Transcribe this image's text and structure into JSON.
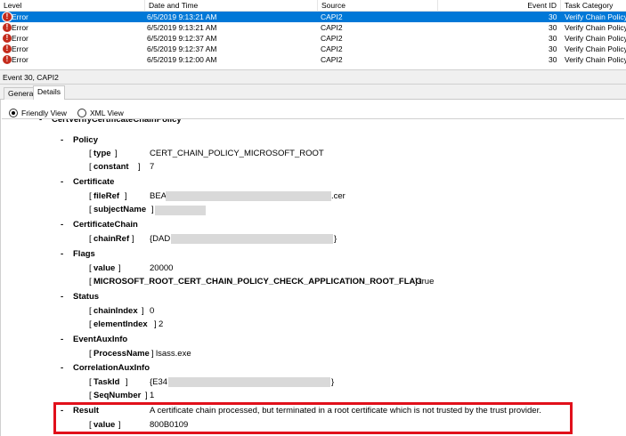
{
  "columns": {
    "level": "Level",
    "datetime": "Date and Time",
    "source": "Source",
    "event_id": "Event ID",
    "task_category": "Task Category"
  },
  "events": [
    {
      "level": "Error",
      "datetime": "6/5/2019 9:13:21 AM",
      "source": "CAPI2",
      "event_id": "30",
      "task_category": "Verify Chain Policy",
      "selected": true
    },
    {
      "level": "Error",
      "datetime": "6/5/2019 9:13:21 AM",
      "source": "CAPI2",
      "event_id": "30",
      "task_category": "Verify Chain Policy"
    },
    {
      "level": "Error",
      "datetime": "6/5/2019 9:12:37 AM",
      "source": "CAPI2",
      "event_id": "30",
      "task_category": "Verify Chain Policy"
    },
    {
      "level": "Error",
      "datetime": "6/5/2019 9:12:37 AM",
      "source": "CAPI2",
      "event_id": "30",
      "task_category": "Verify Chain Policy"
    },
    {
      "level": "Error",
      "datetime": "6/5/2019 9:12:00 AM",
      "source": "CAPI2",
      "event_id": "30",
      "task_category": "Verify Chain Policy"
    }
  ],
  "event_title": "Event 30, CAPI2",
  "tabs": {
    "general": "General",
    "details": "Details"
  },
  "view": {
    "friendly": "Friendly View",
    "xml": "XML View",
    "selected": "Friendly View"
  },
  "tree": {
    "root": "CertVerifyCertificateChainPolicy",
    "minus": "-",
    "lb": "[",
    "rb": "]",
    "policy": {
      "label": "Policy",
      "type_key": "type",
      "type_val": "CERT_CHAIN_POLICY_MICROSOFT_ROOT",
      "constant_key": "constant",
      "constant_val": "7"
    },
    "certificate": {
      "label": "Certificate",
      "fileref_key": "fileRef",
      "fileref_prefix": "BEA",
      "fileref_suffix": ".cer",
      "subject_key": "subjectName"
    },
    "chain": {
      "label": "CertificateChain",
      "chainref_key": "chainRef",
      "chainref_prefix": "{DAD",
      "chainref_suffix": "}"
    },
    "flags": {
      "label": "Flags",
      "value_key": "value",
      "value_val": "20000",
      "flag_key": "MICROSOFT_ROOT_CERT_CHAIN_POLICY_CHECK_APPLICATION_ROOT_FLAG",
      "flag_val": "true"
    },
    "status": {
      "label": "Status",
      "chainindex_key": "chainIndex",
      "chainindex_val": "0",
      "elementindex_key": "elementIndex",
      "elementindex_val": "2"
    },
    "aux": {
      "label": "EventAuxInfo",
      "process_key": "ProcessName",
      "process_val": "lsass.exe"
    },
    "corr": {
      "label": "CorrelationAuxInfo",
      "taskid_key": "TaskId",
      "taskid_prefix": "{E34",
      "taskid_suffix": "}",
      "seq_key": "SeqNumber",
      "seq_val": "1"
    },
    "result": {
      "label": "Result",
      "text": "A certificate chain processed, but terminated in a root certificate which is not trusted by the trust provider.",
      "value_key": "value",
      "value_val": "800B0109"
    }
  },
  "colors": {
    "selection": "#0078d7",
    "error_icon": "#c42b1c",
    "highlight_border": "#e1101b"
  },
  "icons": {
    "error": "error-icon"
  }
}
